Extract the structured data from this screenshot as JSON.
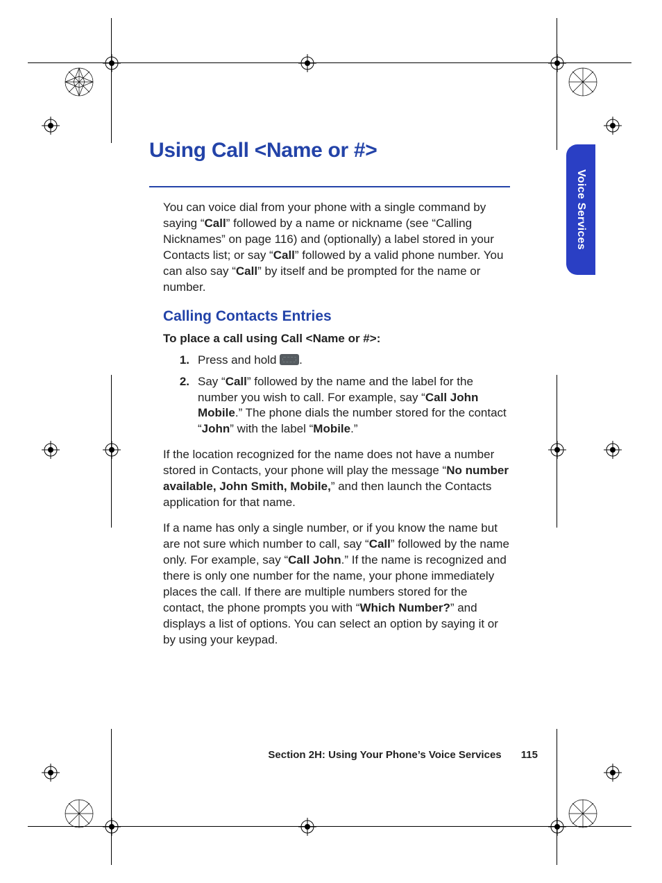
{
  "heading": "Using Call <Name or #>",
  "intro": {
    "pre1": "You can voice dial from your phone with a single command by saying “",
    "b1": "Call",
    "mid1": "” followed by a name or nickname (see “Calling Nicknames” on page 116) and (optionally) a label stored in your Contacts list; or say “",
    "b2": "Call",
    "mid2": "” followed by a valid phone number. You can also say “",
    "b3": "Call",
    "post": "” by itself and be prompted for the name or number."
  },
  "subheading": "Calling Contacts Entries",
  "leadin": "To place a call using Call <Name or #>:",
  "steps": {
    "n1": "1.",
    "s1_pre": "Press and hold ",
    "s1_post": ".",
    "n2": "2.",
    "s2_pre": "Say “",
    "s2_b1": "Call",
    "s2_mid1": "” followed by the name and the label for the number you wish to call. For example, say “",
    "s2_b2": "Call John Mobile",
    "s2_mid2": ".” The phone dials the number stored for the contact “",
    "s2_b3": "John",
    "s2_mid3": "” with the label “",
    "s2_b4": "Mobile",
    "s2_post": ".”"
  },
  "para1": {
    "pre": "If the location recognized for the name does not have a number stored in Contacts, your phone will play the message “",
    "b1": "No number available, John Smith, Mobile,",
    "post": "” and then launch the Contacts application for that name."
  },
  "para2": {
    "pre": "If a name has only a single number, or if you know the name but are not sure which number to call, say “",
    "b1": "Call",
    "mid1": "” followed by the name only. For example, say “",
    "b2": "Call John",
    "mid2": ".” If the name is recognized and there is only one number for the name, your phone immediately places the call. If there are multiple numbers stored for the contact, the phone prompts you with “",
    "b3": "Which Number?",
    "post": "” and displays a list of options. You can select an option by saying it or by using your keypad."
  },
  "sidetab": "Voice Services",
  "footer_section": "Section 2H: Using Your Phone’s Voice Services",
  "footer_page": "115"
}
